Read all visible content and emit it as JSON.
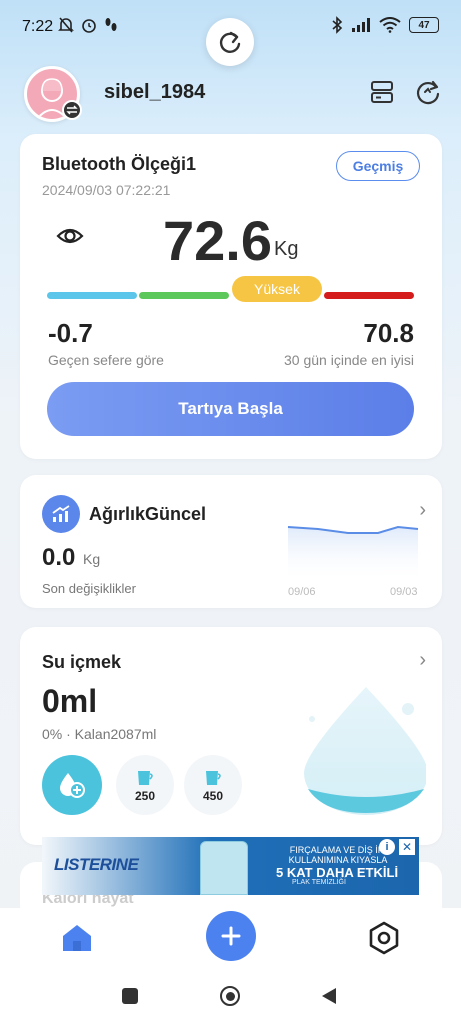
{
  "status_bar": {
    "time": "7:22",
    "battery": "47"
  },
  "header": {
    "username": "sibel_1984"
  },
  "scale_card": {
    "title": "Bluetooth Ölçeği1",
    "datetime": "2024/09/03 07:22:21",
    "history_label": "Geçmiş",
    "weight": "72.6",
    "unit": "Kg",
    "level_label": "Yüksek",
    "level_colors": [
      "#5bc6ea",
      "#5cc85c",
      "#f6c544",
      "#d41c1c"
    ],
    "diff_value": "-0.7",
    "diff_label": "Geçen sefere göre",
    "best_value": "70.8",
    "best_label": "30 gün içinde en iyisi",
    "start_button": "Tartıya Başla"
  },
  "trend_card": {
    "title": "AğırlıkGüncel",
    "value": "0.0",
    "unit": "Kg",
    "label": "Son değişiklikler",
    "chart_start": "09/06",
    "chart_end": "09/03"
  },
  "water_card": {
    "title": "Su içmek",
    "value": "0ml",
    "subtitle": "0% · Kalan2087ml",
    "cups": [
      {
        "amount": "250"
      },
      {
        "amount": "450"
      }
    ]
  },
  "ad": {
    "brand": "LISTERINE",
    "line1": "FIRÇALAMA VE DİŞ İPİ KULLANIMINA KIYASLA",
    "line2": "5 KAT DAHA ETKİLİ",
    "line3": "PLAK TEMİZLİĞİ"
  },
  "next_card": {
    "title": "Kalori hayat"
  },
  "colors": {
    "accent": "#4c82ef",
    "water": "#4cc3dc"
  }
}
